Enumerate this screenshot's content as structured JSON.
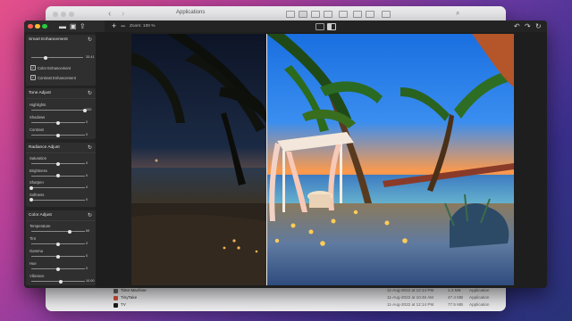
{
  "finder": {
    "nav_back": "‹",
    "nav_forward": "›",
    "title": "Applications",
    "search_icon": "magnifier",
    "rows": [
      {
        "name": "Time Machine",
        "date": "11-Aug-2022 at 12:14 PM",
        "size": "1.3 MB",
        "kind": "Application",
        "icon_color": "#6b6b6b"
      },
      {
        "name": "TinyTake",
        "date": "11-Aug-2022 at 10:45 AM",
        "size": "47.4 MB",
        "kind": "Application",
        "icon_color": "#e0533a"
      },
      {
        "name": "TV",
        "date": "11-Aug-2022 at 12:14 PM",
        "size": "77.5 MB",
        "kind": "Application",
        "icon_color": "#1b1b1b"
      }
    ]
  },
  "app": {
    "toolbar": {
      "open_icon": "folder",
      "photos_icon": "photo",
      "share_icon": "share"
    },
    "editbar": {
      "zoom_in": "+",
      "zoom_out": "−",
      "zoom_label": "Zoom: 100 %",
      "undo": "↶",
      "redo": "↷",
      "refresh": "↻"
    },
    "panels": {
      "smart": {
        "title": "Smart Enhancement",
        "value": "33.41",
        "value_fraction": 0.28,
        "options": [
          {
            "label": "Color Enhancement",
            "checked": true
          },
          {
            "label": "Contrast Enhancement",
            "checked": true
          }
        ]
      },
      "tone": {
        "title": "Tone Adjust",
        "sliders": [
          {
            "label": "Highlights",
            "value": "100",
            "fraction": 1.0
          },
          {
            "label": "Shadows",
            "value": "0",
            "fraction": 0.5
          },
          {
            "label": "Contrast",
            "value": "0",
            "fraction": 0.5
          }
        ]
      },
      "radiance": {
        "title": "Radiance Adjust",
        "sliders": [
          {
            "label": "Saturation",
            "value": "0",
            "fraction": 0.5
          },
          {
            "label": "Brightness",
            "value": "0",
            "fraction": 0.5
          },
          {
            "label": "Sharpen",
            "value": "0",
            "fraction": 0.0
          },
          {
            "label": "Softness",
            "value": "0",
            "fraction": 0.0
          }
        ]
      },
      "color": {
        "title": "Color Adjust",
        "sliders": [
          {
            "label": "Temperature",
            "value": "69",
            "fraction": 0.72
          },
          {
            "label": "Tint",
            "value": "0",
            "fraction": 0.5
          },
          {
            "label": "Gamma",
            "value": "0",
            "fraction": 0.5
          },
          {
            "label": "Hue",
            "value": "0",
            "fraction": 0.5
          },
          {
            "label": "Vibrance",
            "value": "10.00",
            "fraction": 0.55
          }
        ]
      }
    }
  },
  "colors": {
    "accent": "#2d7bf0",
    "close": "#ff5f57",
    "minimize": "#febc2e",
    "zoom": "#28c840"
  }
}
